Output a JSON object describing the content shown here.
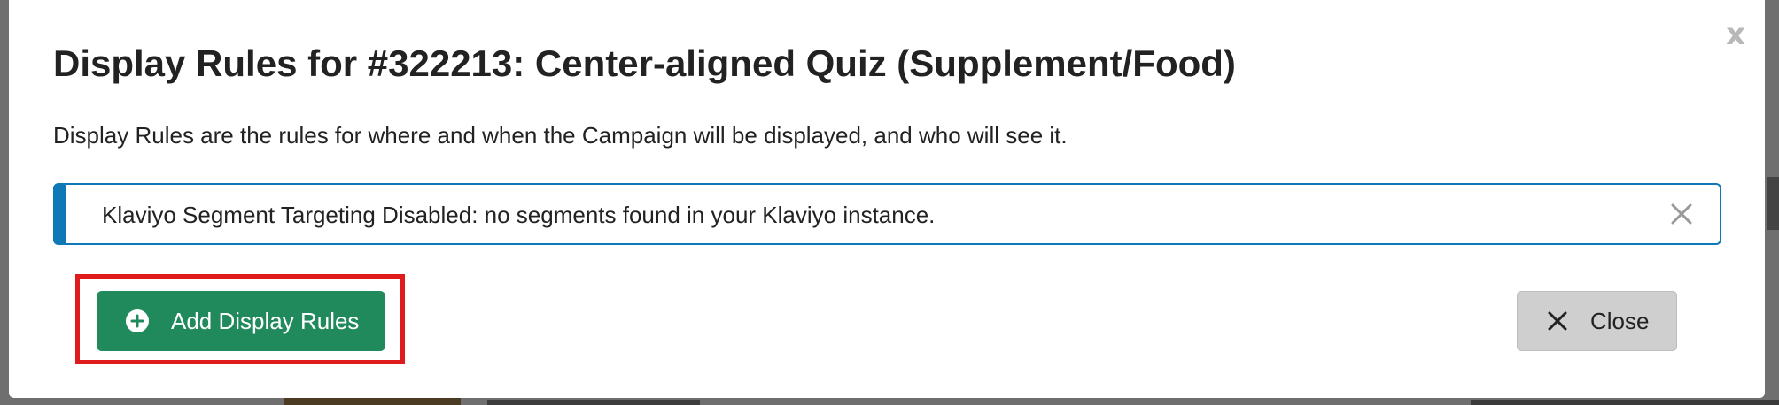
{
  "modal": {
    "title": "Display Rules for #322213: Center-aligned Quiz (Supplement/Food)",
    "close_glyph": "x",
    "description": "Display Rules are the rules for where and when the Campaign will be displayed, and who will see it.",
    "alert": {
      "text": "Klaviyo Segment Targeting Disabled: no segments found in your Klaviyo instance.",
      "dismiss_icon": "close-icon",
      "accent_color": "#0f79b8"
    },
    "buttons": {
      "add_label": "Add Display Rules",
      "add_icon": "plus-circle-icon",
      "add_color": "#218a5d",
      "close_label": "Close",
      "close_icon": "times-icon",
      "close_color": "#cfcfcf"
    },
    "highlight_color": "#e01b1b"
  }
}
